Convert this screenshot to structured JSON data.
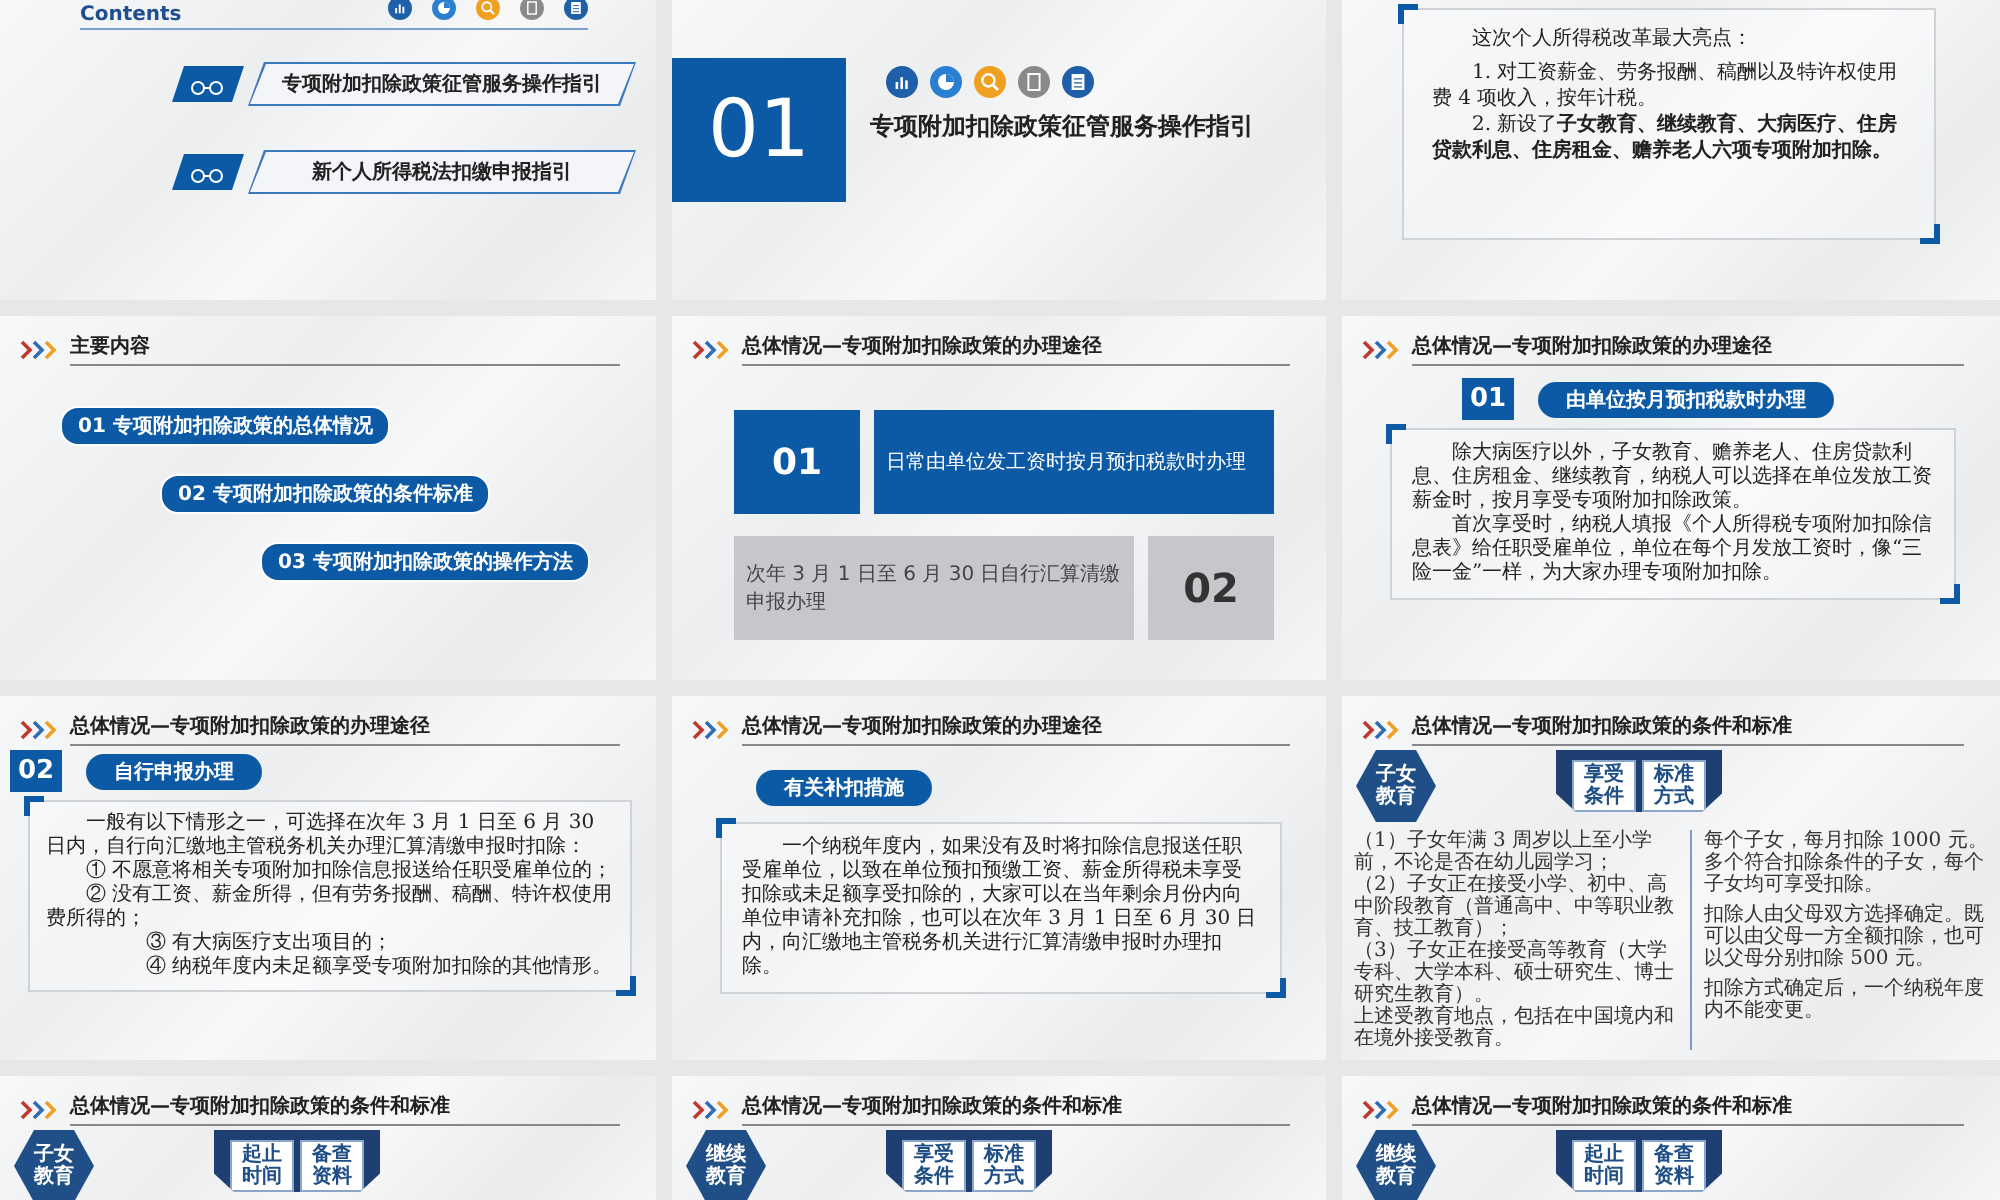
{
  "slides": [
    {
      "kind": "contents",
      "heading": "Contents",
      "items": [
        {
          "text": "专项附加扣除政策征管服务操作指引"
        },
        {
          "text": "新个人所得税法扣缴申报指引"
        }
      ]
    },
    {
      "kind": "section",
      "number": "01",
      "title": "专项附加扣除政策征管服务操作指引"
    },
    {
      "kind": "textbox",
      "paragraphs": [
        {
          "kind": "lead",
          "text": "这次个人所得税改革最大亮点："
        },
        {
          "kind": "item",
          "text": "1. 对工资薪金、劳务报酬、稿酬以及特许权使用费 4 项收入，按年计税。"
        },
        {
          "kind": "item",
          "text": "2. 新设了**子女教育、继续教育、大病医疗、住房贷款利息、住房租金、赡养老人六项专项附加扣除。**"
        }
      ]
    },
    {
      "kind": "agenda",
      "header": "主要内容",
      "items": [
        {
          "number": "01",
          "text": "专项附加扣除政策的总体情况"
        },
        {
          "number": "02",
          "text": "专项附加扣除政策的条件标准"
        },
        {
          "number": "03",
          "text": "专项附加扣除政策的操作方法"
        }
      ]
    },
    {
      "kind": "routes",
      "header": "总体情况—专项附加扣除政策的办理途径",
      "routes": [
        {
          "kind": "number-left",
          "color": "#0c5aa6",
          "number": "01",
          "text": "日常由单位发工资时按月预扣税款时办理"
        },
        {
          "kind": "number-right",
          "color": "#c5c7cb",
          "number": "02",
          "text": "次年 3 月 1 日至 6 月 30 日自行汇算清缴申报办理"
        }
      ]
    },
    {
      "kind": "method",
      "header": "总体情况—专项附加扣除政策的办理途径",
      "number": "01",
      "badge": "由单位按月预扣税款时办理",
      "paragraphs": [
        {
          "kind": "lead",
          "text": "除大病医疗以外，子女教育、赡养老人、住房贷款利息、住房租金、继续教育，纳税人可以选择在单位发放工资薪金时，按月享受专项附加扣除政策。"
        },
        {
          "kind": "lead",
          "text": "首次享受时，纳税人填报《个人所得税专项附加扣除信息表》给任职受雇单位，单位在每个月发放工资时，像“三险一金”一样，为大家办理专项附加扣除。"
        }
      ]
    },
    {
      "kind": "method",
      "header": "总体情况—专项附加扣除政策的办理途径",
      "number": "02",
      "badge": "自行申报办理",
      "paragraphs": [
        {
          "kind": "lead",
          "text": "一般有以下情形之一，可选择在次年 3 月 1 日至 6 月 30 日内，自行向汇缴地主管税务机关办理汇算清缴申报时扣除："
        },
        {
          "kind": "item",
          "text": "① 不愿意将相关专项附加扣除信息报送给任职受雇单位的；"
        },
        {
          "kind": "item",
          "text": "② 没有工资、薪金所得，但有劳务报酬、稿酬、特许权使用费所得的；"
        },
        {
          "kind": "subitem",
          "text": "③ 有大病医疗支出项目的；"
        },
        {
          "kind": "subitem",
          "text": "④ 纳税年度内未足额享受专项附加扣除的其他情形。"
        }
      ]
    },
    {
      "kind": "method",
      "header": "总体情况—专项附加扣除政策的办理途径",
      "badge": "有关补扣措施",
      "paragraphs": [
        {
          "kind": "lead",
          "text": "一个纳税年度内，如果没有及时将扣除信息报送任职受雇单位，以致在单位预扣预缴工资、薪金所得税未享受扣除或未足额享受扣除的，大家可以在当年剩余月份内向单位申请补充扣除，也可以在次年 3 月 1 日至 6 月 30 日内，向汇缴地主管税务机关进行汇算清缴申报时办理扣除。"
        }
      ]
    },
    {
      "kind": "conditions",
      "header": "总体情况—专项附加扣除政策的条件和标准",
      "category": "子女教育",
      "tabs": [
        "享受条件",
        "标准方式"
      ],
      "left": [
        "（1）子女年满 3 周岁以上至小学前，不论是否在幼儿园学习；",
        "（2）子女正在接受小学、初中、高中阶段教育（普通高中、中等职业教育、技工教育）；",
        "（3）子女正在接受高等教育（大学专科、大学本科、硕士研究生、博士研究生教育）。",
        "上述受教育地点，包括在中国境内和在境外接受教育。"
      ],
      "right": [
        "每个子女，每月扣除 1000 元。多个符合扣除条件的子女，每个子女均可享受扣除。",
        "扣除人由父母双方选择确定。既可以由父母一方全额扣除，也可以父母分别扣除 500 元。",
        "扣除方式确定后，一个纳税年度内不能变更。"
      ]
    },
    {
      "kind": "conditions",
      "header": "总体情况—专项附加扣除政策的条件和标准",
      "category": "子女教育",
      "tabs": [
        "起止时间",
        "备查资料"
      ]
    },
    {
      "kind": "conditions",
      "header": "总体情况—专项附加扣除政策的条件和标准",
      "category": "继续教育",
      "tabs": [
        "享受条件",
        "标准方式"
      ]
    },
    {
      "kind": "conditions",
      "header": "总体情况—专项附加扣除政策的条件和标准",
      "category": "继续教育",
      "tabs": [
        "起止时间",
        "备查资料"
      ]
    }
  ]
}
